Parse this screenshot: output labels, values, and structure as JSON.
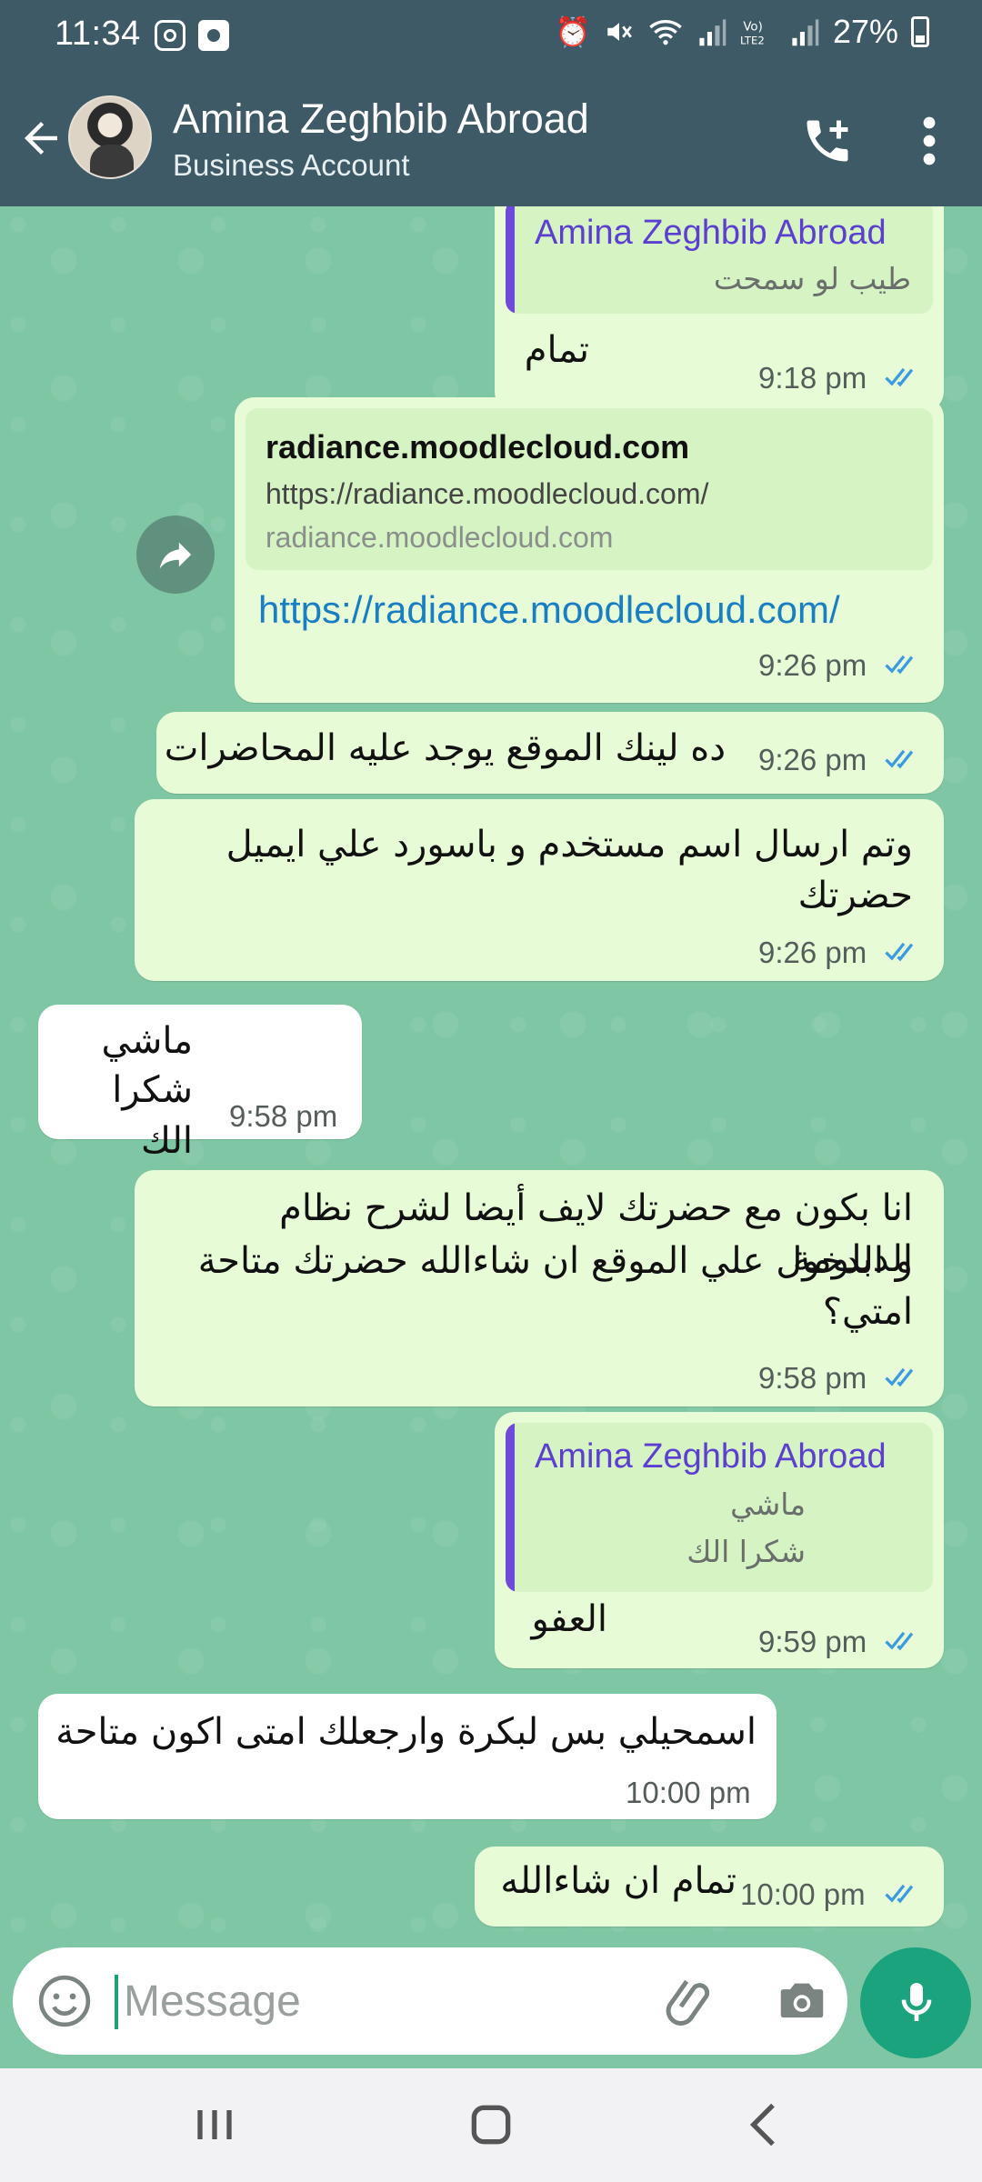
{
  "status_bar": {
    "time": "11:34",
    "battery": "27%",
    "icons": [
      "instagram-icon",
      "app-icon",
      "alarm-icon",
      "mute-icon",
      "wifi-icon",
      "signal-icon",
      "volte-icon",
      "signal-icon-2",
      "battery-icon"
    ]
  },
  "header": {
    "name": "Amina Zeghbib Abroad",
    "subtitle": "Business Account",
    "colors": {
      "bar": "#3d5a66"
    }
  },
  "messages": [
    {
      "dir": "out",
      "quote_name": "Amina Zeghbib Abroad",
      "quote_text": "طيب لو سمحت",
      "text": "تمام",
      "time": "9:18 pm"
    },
    {
      "dir": "out",
      "link_title": "radiance.moodlecloud.com",
      "link_url": "https://radiance.moodlecloud.com/",
      "link_domain": "radiance.moodlecloud.com",
      "text": "https://radiance.moodlecloud.com/",
      "time": "9:26 pm"
    },
    {
      "dir": "out",
      "text": "ده لينك الموقع يوجد عليه المحاضرات",
      "time": "9:26 pm"
    },
    {
      "dir": "out",
      "line1": "وتم ارسال اسم مستخدم و باسورد علي ايميل",
      "line2": "حضرتك",
      "time": "9:26 pm"
    },
    {
      "dir": "in",
      "line1": "ماشي",
      "line2": "شكرا الك",
      "time": "9:58 pm"
    },
    {
      "dir": "out",
      "line1": "انا بكون مع حضرتك لايف أيضا لشرح نظام الدبلومة",
      "line2": "و الدخول علي الموقع ان شاءالله حضرتك متاحة",
      "line3": "امتي؟",
      "time": "9:58 pm"
    },
    {
      "dir": "out",
      "quote_name": "Amina Zeghbib Abroad",
      "quote_line1": "ماشي",
      "quote_line2": "شكرا الك",
      "text": "العفو",
      "time": "9:59 pm"
    },
    {
      "dir": "in",
      "text": "اسمحيلي بس لبكرة وارجعلك امتى اكون متاحة",
      "time": "10:00 pm"
    },
    {
      "dir": "out",
      "text": "تمام ان شاءالله",
      "time": "10:00 pm"
    }
  ],
  "composer": {
    "placeholder": "Message"
  },
  "colors": {
    "chat_bg": "#7fc7a4",
    "outgoing": "#e7fcd6",
    "incoming": "#ffffff",
    "tick": "#3b9be0",
    "mic": "#1ba37d",
    "link": "#1a7fc2",
    "quote_bar": "#6f49d9"
  }
}
